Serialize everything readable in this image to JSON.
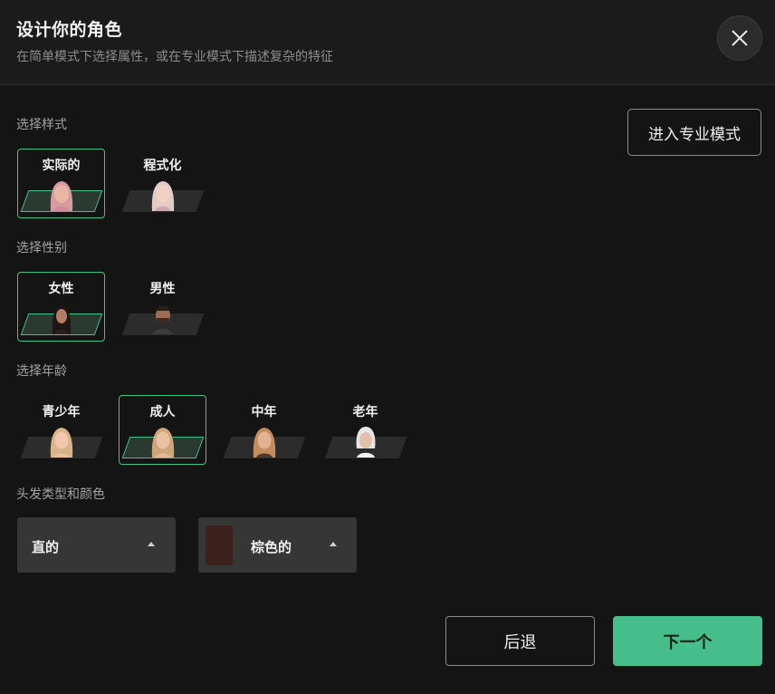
{
  "header": {
    "title": "设计你的角色",
    "subtitle": "在简单模式下选择属性，或在专业模式下描述复杂的特征",
    "close_icon": "close-icon"
  },
  "pro_mode_label": "进入专业模式",
  "style": {
    "label": "选择样式",
    "options": [
      {
        "label": "实际的",
        "selected": true,
        "portrait": "realistic-portrait"
      },
      {
        "label": "程式化",
        "selected": false,
        "portrait": "stylized-portrait"
      }
    ]
  },
  "gender": {
    "label": "选择性别",
    "options": [
      {
        "label": "女性",
        "selected": true,
        "portrait": "female-portrait"
      },
      {
        "label": "男性",
        "selected": false,
        "portrait": "male-portrait"
      }
    ]
  },
  "age": {
    "label": "选择年龄",
    "options": [
      {
        "label": "青少年",
        "selected": false,
        "portrait": "teen-portrait"
      },
      {
        "label": "成人",
        "selected": true,
        "portrait": "adult-portrait"
      },
      {
        "label": "中年",
        "selected": false,
        "portrait": "middle-aged-portrait"
      },
      {
        "label": "老年",
        "selected": false,
        "portrait": "elderly-portrait"
      }
    ]
  },
  "hair": {
    "label": "头发类型和颜色",
    "type_value": "直的",
    "color_value": "棕色的",
    "color_swatch": "#3a211c"
  },
  "footer": {
    "back_label": "后退",
    "next_label": "下一个"
  },
  "colors": {
    "accent": "#45be89",
    "background": "#141414",
    "card_border_selected": "#45c28a"
  }
}
